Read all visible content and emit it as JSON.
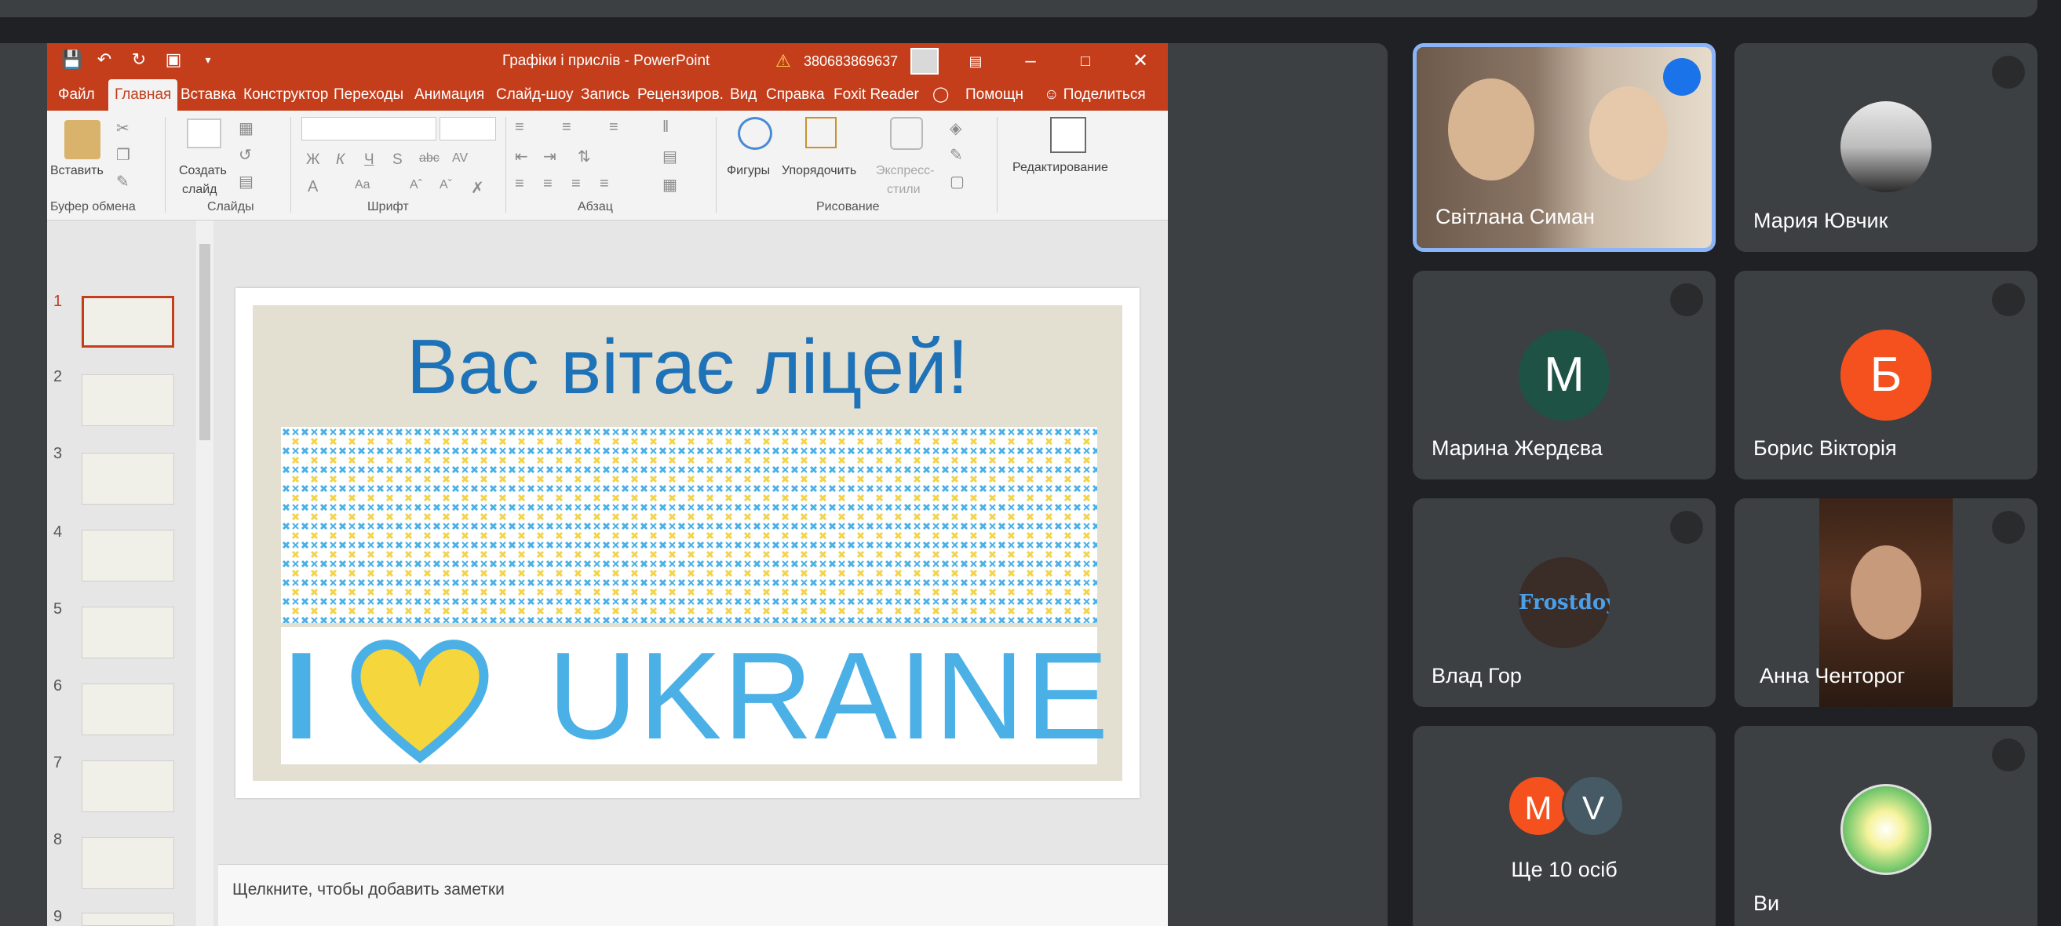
{
  "powerpoint": {
    "document_title": "Графіки і прислів  -  PowerPoint",
    "account": "380683869637",
    "tabs": [
      "Файл",
      "Главная",
      "Вставка",
      "Конструктор",
      "Переходы",
      "Анимация",
      "Слайд-шоу",
      "Запись",
      "Рецензиров.",
      "Вид",
      "Справка",
      "Foxit Reader"
    ],
    "help_label": "Помощн",
    "share_label": "Поделиться",
    "ribbon": {
      "paste": "Вставить",
      "new_slide_1": "Создать",
      "new_slide_2": "слайд",
      "shapes": "Фигуры",
      "arrange": "Упорядочить",
      "express_1": "Экспресс-",
      "express_2": "стили",
      "editing": "Редактирование",
      "group_clipboard": "Буфер обмена",
      "group_slides": "Слайды",
      "group_font": "Шрифт",
      "group_paragraph": "Абзац",
      "group_drawing": "Рисование",
      "font_buttons": [
        "Ж",
        "К",
        "Ч",
        "S",
        "abc",
        "AV"
      ]
    },
    "thumbnail_numbers": [
      "1",
      "2",
      "3",
      "4",
      "5",
      "6",
      "7",
      "8",
      "9"
    ],
    "slide": {
      "title": "Вас вітає ліцей!",
      "i": "I",
      "ukraine": "UKRAINE"
    },
    "notes_placeholder": "Щелкните, чтобы добавить заметки"
  },
  "participants": [
    {
      "name": "Світлана Симан",
      "speaking": true
    },
    {
      "name": "Мария Ювчик"
    },
    {
      "name": "Марина Жердєва",
      "initial": "М",
      "color": "#1e5244"
    },
    {
      "name": "Борис Вікторія",
      "initial": "Б",
      "color": "#f4511e"
    },
    {
      "name": "Влад Гор",
      "logo": "Frostdoy"
    },
    {
      "name": "Анна Ченторог"
    },
    {
      "more_label": "Ще 10 осіб",
      "initials": [
        "M",
        "V"
      ]
    },
    {
      "name": "Ви"
    }
  ]
}
